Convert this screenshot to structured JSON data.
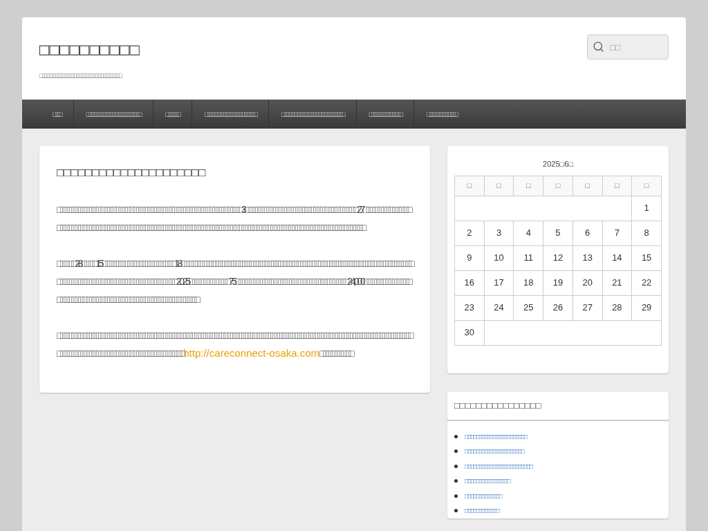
{
  "site": {
    "title": "□□□□□□□□□□",
    "tagline": "□□□□□□□□□□□□□□□□□□□□□□□□□□□□□□"
  },
  "search": {
    "placeholder": "□□"
  },
  "nav": [
    "□□□",
    "□□□□□□□□□□□□□□□□□□□□",
    "□□□□□",
    "□□□□□□□□□□□□□□□□□□□",
    "□□□□□□□□□□□□□□□□□□□□□□□",
    "□□□□□□□□□□□□",
    "□□□□□□□□□□□"
  ],
  "article": {
    "title": "□□□□□□□□□□□□□□□□□□□□□",
    "paragraphs": [
      [
        {
          "kind": "text",
          "text": "□□□□□□□□□□□□□□□□□□□□□□□□□□□□□□□□□□□□□□□□□□□□□□□□□□□3□□□□□□□□□□□□□□□□□□□□□□□□□□□□□□□27□□□□□□□□□□□□□□□□□□□□□□□□□□□□□□□□□□□□□□□□□□□□□□□□□□□□□□□□□□□□□□□□□□□□□□□□□□□□□□□□□□□□□□□□□□□□□□□□□□"
        }
      ],
      [
        {
          "kind": "text",
          "text": "□□□□□28□□□□15□□□□□□□□□□□□□□□□□□□□18□□□□□□□□□□□□□□□□□□□□□□□□□□□□□□□□□□□□□□□□□□□□□□□□□□□□□□□□□□□□□□□□□□□□□□□□□□□□□□□□□□□□□□□□□□□□□□□□□2025□□□□□□□□□□□75□□□□□□□□□□□□□□□□□□□□□□□□□□□□□□□24,000□□□□□□□□□□□□□□□□□□□□□□□□□□□□□□□□□□□□□□□□□□□□□□□□□□□□"
        }
      ],
      [
        {
          "kind": "text",
          "text": "□□□□□□□□□□□□□□□□□□□□□□□□□□□□□□□□□□□□□□□□□□□□□□□□□□□□□□□□□□□□□□□□□□□□□□□□□□□□□□□□□□□□□□□□□□□□□□□□□□□□□□□□□□□□□□□□□□□□□□□□□□□□□□□□□□□□□"
        },
        {
          "kind": "link",
          "text": "http://careconnect-osaka.com"
        },
        {
          "kind": "text",
          "text": "□□□□□□□□□"
        }
      ]
    ]
  },
  "calendar": {
    "caption": "2025□6□",
    "weekdays": [
      "□",
      "□",
      "□",
      "□",
      "□",
      "□",
      "□"
    ],
    "weeks": [
      [
        "1"
      ],
      [
        "2",
        "3",
        "4",
        "5",
        "6",
        "7",
        "8"
      ],
      [
        "9",
        "10",
        "11",
        "12",
        "13",
        "14",
        "15"
      ],
      [
        "16",
        "17",
        "18",
        "19",
        "20",
        "21",
        "22"
      ],
      [
        "23",
        "24",
        "25",
        "26",
        "27",
        "28",
        "29"
      ],
      [
        "30"
      ]
    ]
  },
  "recent_posts": {
    "title": "□□□□□□□□□□□□□□□□",
    "items": [
      "□□□□□□□□□□□□□□□□□□□□□□",
      "□□□□□□□□□□□□□□□□□□□□□",
      "□□□□□□□□□□□□□□□□□□□□□□□□",
      "□□□□□□□□□□□□□□□□",
      "□□□□□□□□□□□□□",
      "□□□□□□□□□□□□"
    ]
  }
}
